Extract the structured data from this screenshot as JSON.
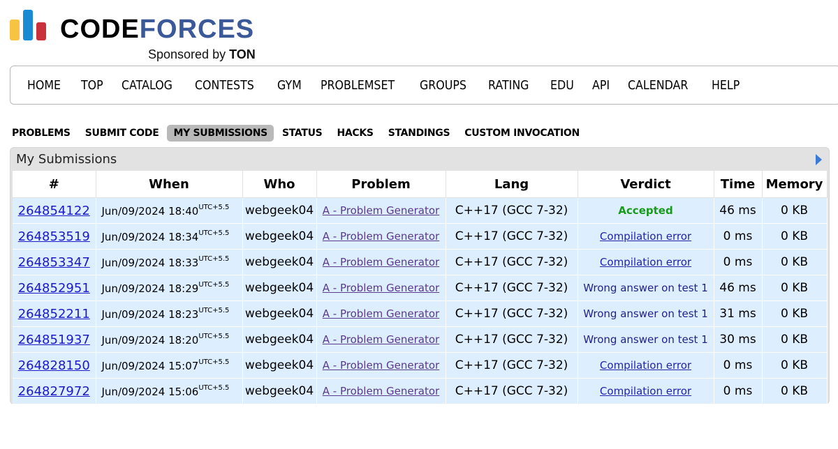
{
  "logo": {
    "word_code": "CODE",
    "word_forces": "FORCES",
    "sponsor_prefix": "Sponsored by ",
    "sponsor_name": "TON"
  },
  "main_menu": [
    "HOME",
    "TOP",
    "CATALOG",
    "CONTESTS",
    "GYM",
    "PROBLEMSET",
    "GROUPS",
    "RATING",
    "EDU",
    "API",
    "CALENDAR",
    "HELP"
  ],
  "sub_menu": {
    "items": [
      "PROBLEMS",
      "SUBMIT CODE",
      "MY SUBMISSIONS",
      "STATUS",
      "HACKS",
      "STANDINGS",
      "CUSTOM INVOCATION"
    ],
    "active": "MY SUBMISSIONS"
  },
  "box": {
    "title": "My Submissions",
    "arrow_icon": "arrow-right-icon"
  },
  "table": {
    "headers": [
      "#",
      "When",
      "Who",
      "Problem",
      "Lang",
      "Verdict",
      "Time",
      "Memory"
    ],
    "tz": "UTC+5.5",
    "rows": [
      {
        "id": "264854122",
        "when": "Jun/09/2024 18:40",
        "who": "webgeek04",
        "problem": "A - Problem Generator",
        "lang": "C++17 (GCC 7-32)",
        "verdict": "Accepted",
        "verdict_type": "accepted",
        "time": "46 ms",
        "memory": "0 KB"
      },
      {
        "id": "264853519",
        "when": "Jun/09/2024 18:34",
        "who": "webgeek04",
        "problem": "A - Problem Generator",
        "lang": "C++17 (GCC 7-32)",
        "verdict": "Compilation error",
        "verdict_type": "ce",
        "time": "0 ms",
        "memory": "0 KB"
      },
      {
        "id": "264853347",
        "when": "Jun/09/2024 18:33",
        "who": "webgeek04",
        "problem": "A - Problem Generator",
        "lang": "C++17 (GCC 7-32)",
        "verdict": "Compilation error",
        "verdict_type": "ce",
        "time": "0 ms",
        "memory": "0 KB"
      },
      {
        "id": "264852951",
        "when": "Jun/09/2024 18:29",
        "who": "webgeek04",
        "problem": "A - Problem Generator",
        "lang": "C++17 (GCC 7-32)",
        "verdict": "Wrong answer on test 1",
        "verdict_type": "wa",
        "time": "46 ms",
        "memory": "0 KB"
      },
      {
        "id": "264852211",
        "when": "Jun/09/2024 18:23",
        "who": "webgeek04",
        "problem": "A - Problem Generator",
        "lang": "C++17 (GCC 7-32)",
        "verdict": "Wrong answer on test 1",
        "verdict_type": "wa",
        "time": "31 ms",
        "memory": "0 KB"
      },
      {
        "id": "264851937",
        "when": "Jun/09/2024 18:20",
        "who": "webgeek04",
        "problem": "A - Problem Generator",
        "lang": "C++17 (GCC 7-32)",
        "verdict": "Wrong answer on test 1",
        "verdict_type": "wa",
        "time": "30 ms",
        "memory": "0 KB"
      },
      {
        "id": "264828150",
        "when": "Jun/09/2024 15:07",
        "who": "webgeek04",
        "problem": "A - Problem Generator",
        "lang": "C++17 (GCC 7-32)",
        "verdict": "Compilation error",
        "verdict_type": "ce",
        "time": "0 ms",
        "memory": "0 KB"
      },
      {
        "id": "264827972",
        "when": "Jun/09/2024 15:06",
        "who": "webgeek04",
        "problem": "A - Problem Generator",
        "lang": "C++17 (GCC 7-32)",
        "verdict": "Compilation error",
        "verdict_type": "ce",
        "time": "0 ms",
        "memory": "0 KB"
      }
    ]
  },
  "colors": {
    "brand_blue": "#3b5998",
    "row_bg": "#ddeeff",
    "accepted": "#1a9a1a",
    "link": "#1a1ac8"
  }
}
